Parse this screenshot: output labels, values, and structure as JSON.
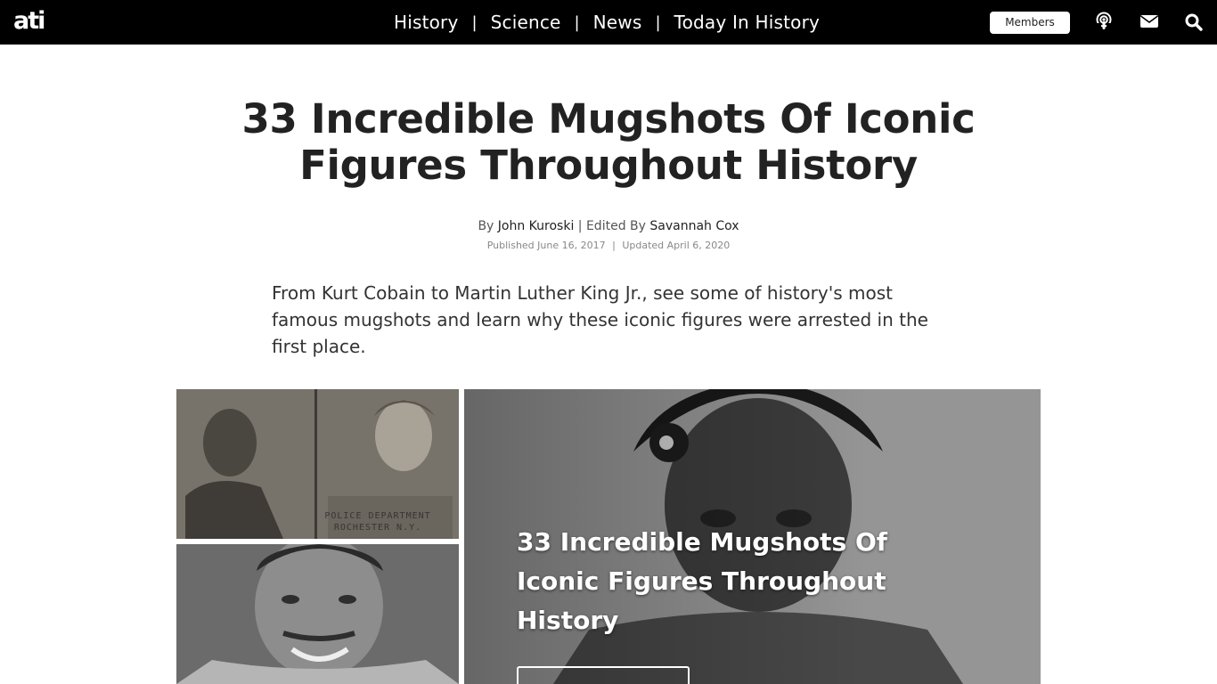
{
  "site": {
    "logo": "ati"
  },
  "nav": {
    "items": [
      "History",
      "Science",
      "News",
      "Today In History"
    ],
    "separator": "|",
    "members_label": "Members",
    "icons": [
      "podcast-icon",
      "envelope-icon",
      "search-icon"
    ]
  },
  "article": {
    "title": "33 Incredible Mugshots Of Iconic Figures Throughout History",
    "byline_prefix": "By",
    "author": "John Kuroski",
    "edited_prefix": "| Edited By",
    "editor": "Savannah Cox",
    "published": "Published June 16, 2017",
    "date_sep": "|",
    "updated": "Updated April 6, 2020",
    "dek": "From Kurt Cobain to Martin Luther King Jr., see some of history's most famous mugshots and learn why these iconic figures were arrested in the first place."
  },
  "gallery": {
    "mugshot_label_line1": "POLICE  DEPARTMENT",
    "mugshot_label_line2": "ROCHESTER N.Y.",
    "hero_title": "33 Incredible Mugshots Of Iconic Figures Throughout History"
  }
}
